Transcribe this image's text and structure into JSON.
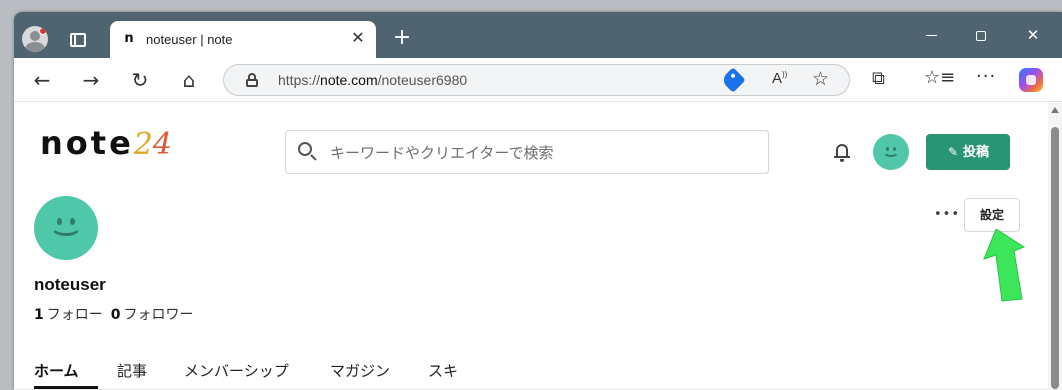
{
  "browser": {
    "tab_title": "noteuser | note",
    "tab_favicon": "n",
    "url_prefix": "https://",
    "url_host": "note.com",
    "url_path": "/noteuser6980",
    "icons": {
      "profile": "profile-icon",
      "tabs": "tab-actions-icon",
      "close": "close-icon",
      "new_tab": "plus-icon",
      "back": "back-arrow-icon",
      "forward": "forward-arrow-icon",
      "reload": "reload-icon",
      "home": "home-icon",
      "lock": "lock-icon",
      "tag": "shopping-tag-icon",
      "read_aloud": "read-aloud-icon",
      "favorite": "star-icon",
      "extensions": "puzzle-icon",
      "favorites": "favorites-icon",
      "more": "more-icon",
      "copilot": "copilot-icon"
    }
  },
  "site": {
    "logo_text": "note",
    "logo_year_1": "2",
    "logo_year_2": "4",
    "search_placeholder": "キーワードやクリエイターで検索",
    "post_label": "投稿",
    "colors": {
      "accent_green": "#2a9574",
      "avatar": "#4ec8a8",
      "arrow": "#3ce65a"
    }
  },
  "profile": {
    "name": "noteuser",
    "follow_count": "1",
    "follow_label": "フォロー",
    "follower_count": "0",
    "follower_label": "フォロワー",
    "menu_dots": "•••",
    "settings_label": "設定"
  },
  "tabs": [
    {
      "label": "ホーム",
      "active": true
    },
    {
      "label": "記事",
      "active": false
    },
    {
      "label": "メンバーシップ",
      "active": false
    },
    {
      "label": "マガジン",
      "active": false
    },
    {
      "label": "スキ",
      "active": false
    }
  ]
}
